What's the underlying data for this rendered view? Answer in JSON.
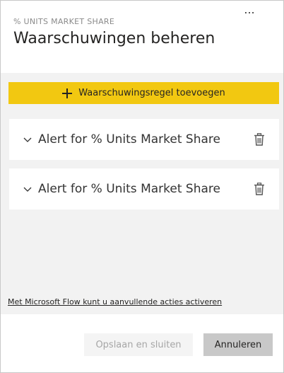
{
  "header": {
    "subtitle": "% UNITS MARKET SHARE",
    "title": "Waarschuwingen beheren",
    "more_label": "..."
  },
  "add_rule": {
    "label": "Waarschuwingsregel toevoegen",
    "icon": "plus-icon",
    "color": "#f2c811"
  },
  "alerts": [
    {
      "label": "Alert for % Units Market Share",
      "expand_icon": "chevron-down-icon",
      "delete_icon": "trash-icon"
    },
    {
      "label": "Alert for % Units Market Share",
      "expand_icon": "chevron-down-icon",
      "delete_icon": "trash-icon"
    }
  ],
  "flow_link": "Met Microsoft Flow kunt u aanvullende acties activeren",
  "footer": {
    "save_label": "Opslaan en sluiten",
    "cancel_label": "Annuleren"
  }
}
